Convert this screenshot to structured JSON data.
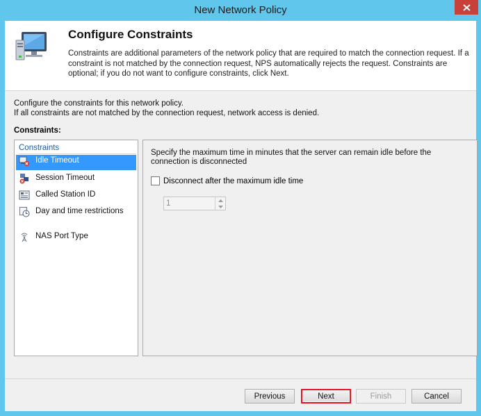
{
  "window": {
    "title": "New Network Policy"
  },
  "header": {
    "title": "Configure Constraints",
    "description": "Constraints are additional parameters of the network policy that are required to match the connection request. If a constraint is not matched by the connection request, NPS automatically rejects the request. Constraints are optional; if you do not want to configure constraints, click Next."
  },
  "intro": {
    "line1": "Configure the constraints for this network policy.",
    "line2": "If all constraints are not matched by the connection request, network access is denied."
  },
  "constraints_label": "Constraints:",
  "left_panel": {
    "heading": "Constraints",
    "items": [
      {
        "label": "Idle Timeout",
        "icon": "idle-timeout-icon",
        "selected": true
      },
      {
        "label": "Session Timeout",
        "icon": "session-timeout-icon"
      },
      {
        "label": "Called Station ID",
        "icon": "called-station-id-icon"
      },
      {
        "label": "Day and time restrictions",
        "icon": "clock-icon"
      },
      {
        "label": "NAS Port Type",
        "icon": "nas-port-type-icon"
      }
    ]
  },
  "right_panel": {
    "description": "Specify the maximum time in minutes that the server can remain idle before the connection is disconnected",
    "checkbox_label": "Disconnect after the maximum idle time",
    "checkbox_checked": false,
    "spinner_value": "1"
  },
  "buttons": {
    "previous": "Previous",
    "next": "Next",
    "finish": "Finish",
    "cancel": "Cancel"
  },
  "colors": {
    "titlebar": "#60c6ec",
    "selection": "#3399ff",
    "close": "#c7403a",
    "focus_border": "#e81123"
  }
}
